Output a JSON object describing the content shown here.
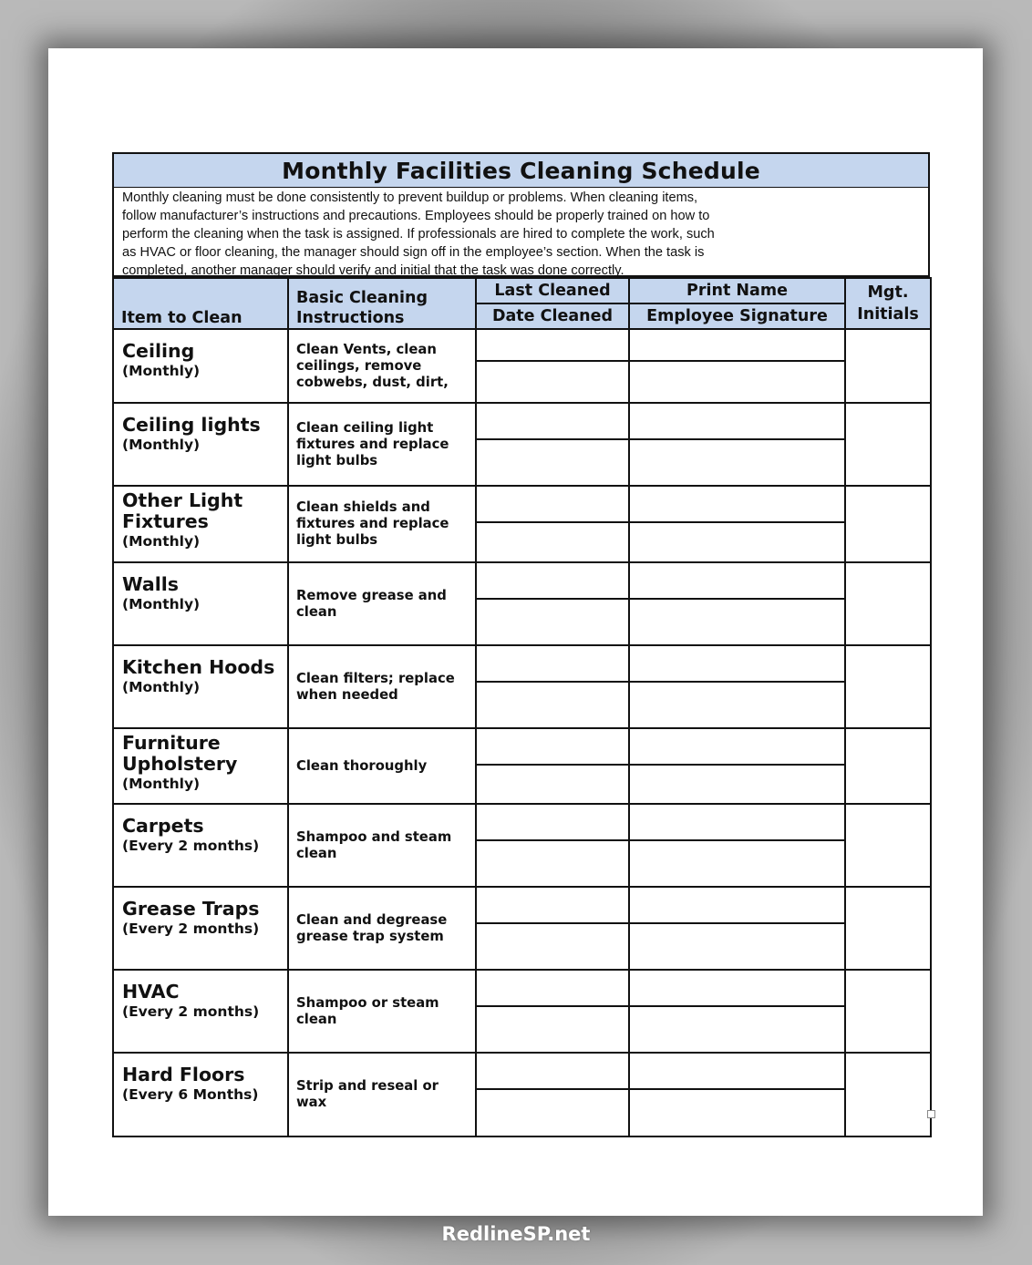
{
  "document": {
    "title": "Monthly Facilities Cleaning Schedule",
    "intro": "Monthly cleaning must be done consistently to prevent buildup or problems. When cleaning items, follow manufacturer’s instructions and precautions. Employees should be properly trained on how to perform the cleaning when the task is assigned. If professionals are hired to complete the work, such as HVAC or floor cleaning, the manager should sign off in the employee’s section. When the task is completed, another manager should verify and initial that the task was done correctly.",
    "intro_lines": [
      "Monthly  cleaning  must be done consistently  to prevent buildup  or problems. When cleaning items,",
      "follow manufacturer’s instructions  and precautions. Employees should be properly trained on how to",
      "perform the cleaning  when the task is assigned.  If professionals are hired to complete the work, such",
      "as HVAC or floor cleaning,  the manager should sign off in the employee’s section. When the task is",
      "completed,  another manager should verify and initial  that the task was done correctly."
    ],
    "colors": {
      "header_fill": "#c5d6ee",
      "border": "#111111"
    }
  },
  "table": {
    "headers": {
      "item": "Item to Clean",
      "instructions_line1": "Basic Cleaning",
      "instructions_line2": "Instructions",
      "date_top": "Last Cleaned",
      "date_bottom": "Date Cleaned",
      "name_top": "Print Name",
      "name_bottom": "Employee Signature",
      "mgt_line1": "Mgt.",
      "mgt_line2": "Initials"
    },
    "rows": [
      {
        "item": [
          "Ceiling"
        ],
        "frequency": "(Monthly)",
        "instructions": "Clean Vents, clean ceilings, remove cobwebs, dust, dirt,",
        "last_cleaned": "",
        "date_cleaned": "",
        "print_name": "",
        "employee_signature": "",
        "mgt_initials": ""
      },
      {
        "item": [
          "Ceiling lights"
        ],
        "frequency": "(Monthly)",
        "instructions": "Clean ceiling light fixtures and replace light bulbs",
        "last_cleaned": "",
        "date_cleaned": "",
        "print_name": "",
        "employee_signature": "",
        "mgt_initials": ""
      },
      {
        "item": [
          "Other Light",
          "Fixtures"
        ],
        "frequency": "(Monthly)",
        "instructions": "Clean shields and fixtures and replace light bulbs",
        "last_cleaned": "",
        "date_cleaned": "",
        "print_name": "",
        "employee_signature": "",
        "mgt_initials": ""
      },
      {
        "item": [
          "Walls"
        ],
        "frequency": "(Monthly)",
        "instructions": "Remove grease and clean",
        "last_cleaned": "",
        "date_cleaned": "",
        "print_name": "",
        "employee_signature": "",
        "mgt_initials": ""
      },
      {
        "item": [
          "Kitchen Hoods"
        ],
        "frequency": "(Monthly)",
        "instructions": "Clean filters; replace when needed",
        "last_cleaned": "",
        "date_cleaned": "",
        "print_name": "",
        "employee_signature": "",
        "mgt_initials": ""
      },
      {
        "item": [
          "Furniture",
          "Upholstery"
        ],
        "frequency": "(Monthly)",
        "instructions": "Clean thoroughly",
        "last_cleaned": "",
        "date_cleaned": "",
        "print_name": "",
        "employee_signature": "",
        "mgt_initials": ""
      },
      {
        "item": [
          "Carpets"
        ],
        "frequency": "(Every 2 months)",
        "instructions": "Shampoo and steam clean",
        "last_cleaned": "",
        "date_cleaned": "",
        "print_name": "",
        "employee_signature": "",
        "mgt_initials": ""
      },
      {
        "item": [
          "Grease Traps"
        ],
        "frequency": "(Every 2 months)",
        "instructions": "Clean and degrease grease trap system",
        "last_cleaned": "",
        "date_cleaned": "",
        "print_name": "",
        "employee_signature": "",
        "mgt_initials": ""
      },
      {
        "item": [
          "HVAC"
        ],
        "frequency": "(Every 2 months)",
        "instructions": "Shampoo or steam clean",
        "last_cleaned": "",
        "date_cleaned": "",
        "print_name": "",
        "employee_signature": "",
        "mgt_initials": ""
      },
      {
        "item": [
          "Hard Floors"
        ],
        "frequency": "(Every 6 Months)",
        "instructions": "Strip and reseal or wax",
        "last_cleaned": "",
        "date_cleaned": "",
        "print_name": "",
        "employee_signature": "",
        "mgt_initials": ""
      }
    ]
  },
  "watermark": "RedlineSP.net"
}
